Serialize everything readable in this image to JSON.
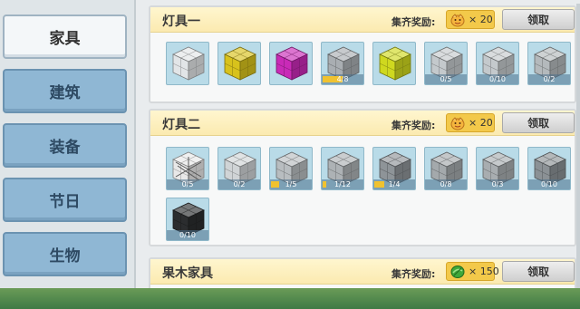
{
  "colors": {
    "accent_gold": "#f3c94a",
    "tab_blue": "#8fb7d4",
    "slot_bg": "#b9dbe8",
    "progress_fill": "#f0c230"
  },
  "sidebar": {
    "tabs": [
      {
        "label": "家具",
        "active": true
      },
      {
        "label": "建筑",
        "active": false
      },
      {
        "label": "装备",
        "active": false
      },
      {
        "label": "节日",
        "active": false
      },
      {
        "label": "生物",
        "active": false
      }
    ]
  },
  "sets": [
    {
      "title": "灯具一",
      "reward_label": "集齐奖励:",
      "reward_icon": "face-token-icon",
      "reward_amount": "× 20",
      "claim_label": "领取",
      "items": [
        {
          "icon": "white-block-icon",
          "color": "#e2e5e7",
          "count": "",
          "progress": null
        },
        {
          "icon": "yellow-magenta-block-icon",
          "color": "#d8c21c",
          "count": "",
          "progress": null
        },
        {
          "icon": "magenta-block-icon",
          "color": "#c92ab7",
          "count": "",
          "progress": null
        },
        {
          "icon": "gray-block-icon",
          "color": "#a9aeb2",
          "count": "4/8",
          "progress": 0.5
        },
        {
          "icon": "yellow-block-icon",
          "color": "#cfd81f",
          "count": "",
          "progress": null
        },
        {
          "icon": "light-gray-block-icon",
          "color": "#c4c9cc",
          "count": "0/5",
          "progress": 0
        },
        {
          "icon": "light-gray-block-icon",
          "color": "#c4c9cc",
          "count": "0/10",
          "progress": 0
        },
        {
          "icon": "gray-block-icon",
          "color": "#b4b9bc",
          "count": "0/2",
          "progress": 0
        }
      ]
    },
    {
      "title": "灯具二",
      "reward_label": "集齐奖励:",
      "reward_icon": "face-token-icon",
      "reward_amount": "× 20",
      "claim_label": "领取",
      "items": [
        {
          "icon": "lattice-block-icon",
          "color": "#e8e8e8",
          "count": "0/5",
          "progress": 0
        },
        {
          "icon": "light-gray-block-icon",
          "color": "#d0d4d6",
          "count": "0/2",
          "progress": 0
        },
        {
          "icon": "gray-block-icon",
          "color": "#b8bdc0",
          "count": "1/5",
          "progress": 0.2
        },
        {
          "icon": "gray-block-icon",
          "color": "#adb2b5",
          "count": "1/12",
          "progress": 0.083
        },
        {
          "icon": "dark-gray-block-icon",
          "color": "#8e9498",
          "count": "1/4",
          "progress": 0.25
        },
        {
          "icon": "gray-block-icon",
          "color": "#a4a9ac",
          "count": "0/8",
          "progress": 0
        },
        {
          "icon": "gray-block-icon",
          "color": "#a8adb0",
          "count": "0/3",
          "progress": 0
        },
        {
          "icon": "dark-gray-block-icon",
          "color": "#8b9195",
          "count": "0/10",
          "progress": 0
        },
        {
          "icon": "black-block-icon",
          "color": "#2b2d2f",
          "count": "0/10",
          "progress": 0
        }
      ]
    },
    {
      "title": "果木家具",
      "reward_label": "集齐奖励:",
      "reward_icon": "green-gem-icon",
      "reward_amount": "× 150",
      "claim_label": "领取",
      "items": []
    }
  ]
}
